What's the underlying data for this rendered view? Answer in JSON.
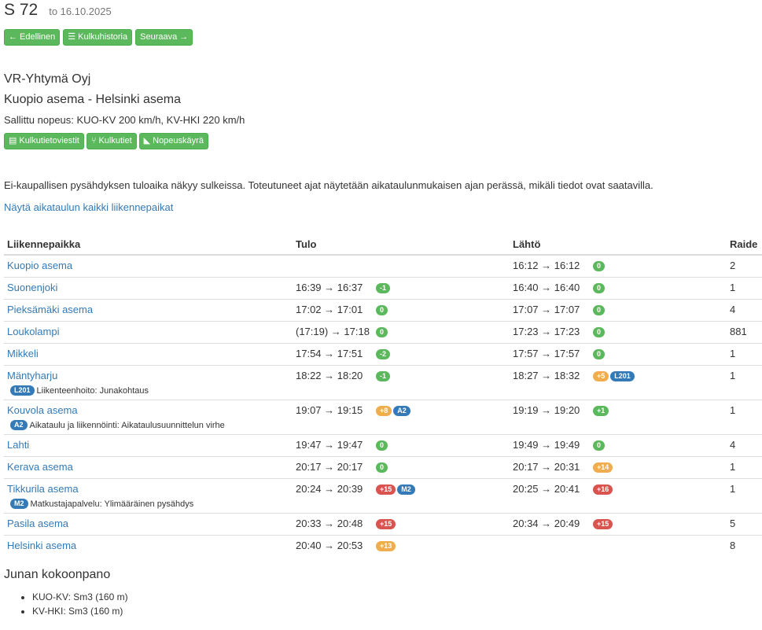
{
  "header": {
    "title": "S 72",
    "date": "to 16.10.2025"
  },
  "nav": {
    "prev": "Edellinen",
    "history": "Kulkuhistoria",
    "next": "Seuraava"
  },
  "train": {
    "operator": "VR-Yhtymä Oyj",
    "route": "Kuopio asema - Helsinki asema",
    "speed": "Sallittu nopeus: KUO-KV 200 km/h, KV-HKI 220 km/h"
  },
  "actions": {
    "notice": "Kulkutietoviestit",
    "routes": "Kulkutiet",
    "speed_curve": "Nopeuskäyrä"
  },
  "info_text": "Ei-kaupallisen pysähdyksen tuloaika näkyy sulkeissa. Toteutuneet ajat näytetään aikataulunmukaisen ajan perässä, mikäli tiedot ovat saatavilla.",
  "show_all_link": "Näytä aikataulun kaikki liikennepaikat",
  "table": {
    "headers": {
      "station": "Liikennepaikka",
      "arrival": "Tulo",
      "departure": "Lähtö",
      "track": "Raide"
    },
    "rows": [
      {
        "station": "Kuopio asema",
        "arr": "",
        "arr_badges": [],
        "dep": "16:12 → 16:12",
        "dep_badges": [
          {
            "text": "0",
            "color": "#5cb85c"
          }
        ],
        "track": "2",
        "cause": null
      },
      {
        "station": "Suonenjoki",
        "arr": "16:39 → 16:37",
        "arr_badges": [
          {
            "text": "-1",
            "color": "#5cb85c"
          }
        ],
        "dep": "16:40 → 16:40",
        "dep_badges": [
          {
            "text": "0",
            "color": "#5cb85c"
          }
        ],
        "track": "1",
        "cause": null
      },
      {
        "station": "Pieksämäki asema",
        "arr": "17:02 → 17:01",
        "arr_badges": [
          {
            "text": "0",
            "color": "#5cb85c"
          }
        ],
        "dep": "17:07 → 17:07",
        "dep_badges": [
          {
            "text": "0",
            "color": "#5cb85c"
          }
        ],
        "track": "4",
        "cause": null
      },
      {
        "station": "Loukolampi",
        "arr": "(17:19) → 17:18",
        "arr_badges": [
          {
            "text": "0",
            "color": "#5cb85c"
          }
        ],
        "dep": "17:23 → 17:23",
        "dep_badges": [
          {
            "text": "0",
            "color": "#5cb85c"
          }
        ],
        "track": "881",
        "cause": null
      },
      {
        "station": "Mikkeli",
        "arr": "17:54 → 17:51",
        "arr_badges": [
          {
            "text": "-2",
            "color": "#5cb85c"
          }
        ],
        "dep": "17:57 → 17:57",
        "dep_badges": [
          {
            "text": "0",
            "color": "#5cb85c"
          }
        ],
        "track": "1",
        "cause": null
      },
      {
        "station": "Mäntyharju",
        "arr": "18:22 → 18:20",
        "arr_badges": [
          {
            "text": "-1",
            "color": "#5cb85c"
          }
        ],
        "dep": "18:27 → 18:32",
        "dep_badges": [
          {
            "text": "+5",
            "color": "#f0ad4e"
          },
          {
            "text": "L201",
            "color": "#337ab7"
          }
        ],
        "track": "1",
        "cause": {
          "code": "L201",
          "text": "Liikenteenhoito: Junakohtaus"
        }
      },
      {
        "station": "Kouvola asema",
        "arr": "19:07 → 19:15",
        "arr_badges": [
          {
            "text": "+8",
            "color": "#f0ad4e"
          },
          {
            "text": "A2",
            "color": "#337ab7"
          }
        ],
        "dep": "19:19 → 19:20",
        "dep_badges": [
          {
            "text": "+1",
            "color": "#5cb85c"
          }
        ],
        "track": "1",
        "cause": {
          "code": "A2",
          "text": "Aikataulu ja liikennöinti: Aikataulusuunnittelun virhe"
        }
      },
      {
        "station": "Lahti",
        "arr": "19:47 → 19:47",
        "arr_badges": [
          {
            "text": "0",
            "color": "#5cb85c"
          }
        ],
        "dep": "19:49 → 19:49",
        "dep_badges": [
          {
            "text": "0",
            "color": "#5cb85c"
          }
        ],
        "track": "4",
        "cause": null
      },
      {
        "station": "Kerava asema",
        "arr": "20:17 → 20:17",
        "arr_badges": [
          {
            "text": "0",
            "color": "#5cb85c"
          }
        ],
        "dep": "20:17 → 20:31",
        "dep_badges": [
          {
            "text": "+14",
            "color": "#f0ad4e"
          }
        ],
        "track": "1",
        "cause": null
      },
      {
        "station": "Tikkurila asema",
        "arr": "20:24 → 20:39",
        "arr_badges": [
          {
            "text": "+15",
            "color": "#d9534f"
          },
          {
            "text": "M2",
            "color": "#337ab7"
          }
        ],
        "dep": "20:25 → 20:41",
        "dep_badges": [
          {
            "text": "+16",
            "color": "#d9534f"
          }
        ],
        "track": "1",
        "cause": {
          "code": "M2",
          "text": "Matkustajapalvelu: Ylimääräinen pysähdys"
        }
      },
      {
        "station": "Pasila asema",
        "arr": "20:33 → 20:48",
        "arr_badges": [
          {
            "text": "+15",
            "color": "#d9534f"
          }
        ],
        "dep": "20:34 → 20:49",
        "dep_badges": [
          {
            "text": "+15",
            "color": "#d9534f"
          }
        ],
        "track": "5",
        "cause": null
      },
      {
        "station": "Helsinki asema",
        "arr": "20:40 → 20:53",
        "arr_badges": [
          {
            "text": "+13",
            "color": "#f0ad4e"
          }
        ],
        "dep": "",
        "dep_badges": [],
        "track": "8",
        "cause": null
      }
    ]
  },
  "composition": {
    "title": "Junan kokoonpano",
    "items": [
      "KUO-KV: Sm3 (160 m)",
      "KV-HKI: Sm3 (160 m)"
    ]
  }
}
